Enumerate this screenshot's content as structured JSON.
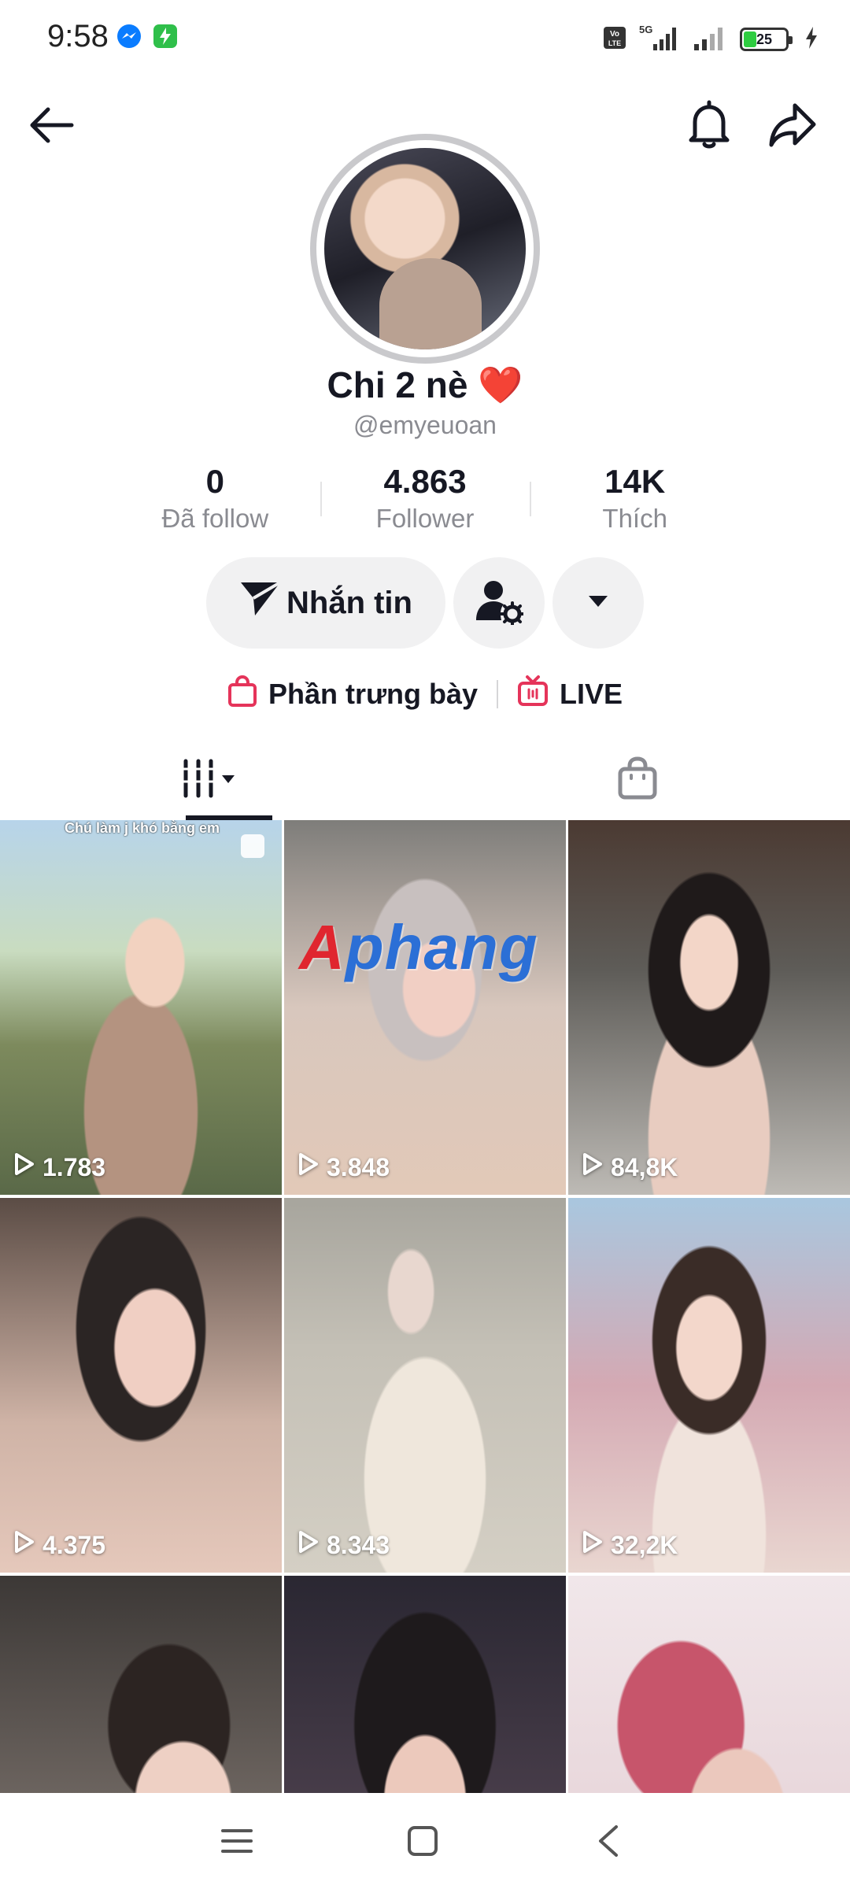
{
  "status_bar": {
    "time": "9:58",
    "battery": "25",
    "network": "5G",
    "volte": "Vo LTE",
    "icons": [
      "messenger-icon",
      "app-notification-icon",
      "volte-icon",
      "signal-5g-icon",
      "signal-icon",
      "battery-icon",
      "charging-icon"
    ]
  },
  "top_nav": {
    "icons": [
      "back-arrow-icon",
      "bell-icon",
      "share-icon"
    ]
  },
  "profile": {
    "display_name": "Chi 2 nè",
    "name_emoji": "❤️",
    "username": "@emyeuoan"
  },
  "stats": [
    {
      "value": "0",
      "label": "Đã follow"
    },
    {
      "value": "4.863",
      "label": "Follower"
    },
    {
      "value": "14K",
      "label": "Thích"
    }
  ],
  "actions": {
    "message_label": "Nhắn tin",
    "icons": [
      "send-icon",
      "user-settings-icon",
      "dropdown-arrow-icon"
    ]
  },
  "links": {
    "showcase_label": "Phần trưng bày",
    "live_label": "LIVE"
  },
  "tabs": [
    {
      "name": "videos",
      "icon": "grid-sort-icon",
      "active": true
    },
    {
      "name": "shop",
      "icon": "shopping-bag-icon",
      "active": false
    }
  ],
  "videos": [
    {
      "views": "1.783",
      "caption": "Chú làm j khó bằng em"
    },
    {
      "views": "3.848"
    },
    {
      "views": "84,8K"
    },
    {
      "views": "4.375"
    },
    {
      "views": "8.343"
    },
    {
      "views": "32,2K"
    },
    {
      "views": ""
    },
    {
      "views": ""
    },
    {
      "views": ""
    }
  ],
  "watermark": "Aphang",
  "bottom_nav": {
    "icons": [
      "menu-icon",
      "home-square-icon",
      "back-chevron-icon"
    ]
  }
}
